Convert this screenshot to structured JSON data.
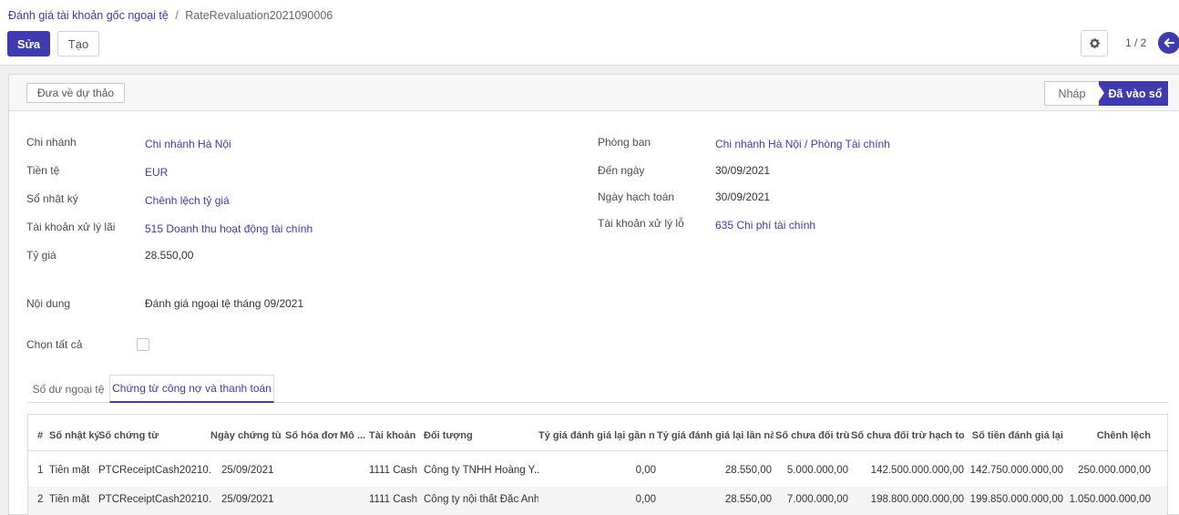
{
  "breadcrumb": {
    "parent": "Đánh giá tài khoản gốc ngoại tệ",
    "separator": "/",
    "current": "RateRevaluation2021090006"
  },
  "toolbar": {
    "edit_label": "Sửa",
    "create_label": "Tạo",
    "pager": "1 / 2",
    "gear_icon": "gear-icon",
    "back_icon": "arrow-left-icon"
  },
  "statusbar": {
    "reset_label": "Đưa về dự thảo",
    "stages": [
      "Nháp",
      "Đã vào sổ"
    ],
    "active_stage": "Đã vào sổ"
  },
  "form": {
    "left": [
      {
        "label": "Chi nhánh",
        "value": "Chi nhánh Hà Nội",
        "link": true
      },
      {
        "label": "Tiền tệ",
        "value": "EUR",
        "link": true
      },
      {
        "label": "Sổ nhật ký",
        "value": "Chênh lệch tỷ giá",
        "link": true
      },
      {
        "label": "Tài khoản xử lý lãi",
        "value": "515 Doanh thu hoạt động tài chính",
        "link": true
      },
      {
        "label": "Tỷ giá",
        "value": "28.550,00",
        "link": false
      }
    ],
    "right": [
      {
        "label": "Phòng ban",
        "value": "Chi nhánh Hà Nội / Phòng Tài chính",
        "link": true
      },
      {
        "label": "Đến ngày",
        "value": "30/09/2021",
        "link": false
      },
      {
        "label": "Ngày hạch toán",
        "value": "30/09/2021",
        "link": false
      },
      {
        "label": "Tài khoản xử lý lỗ",
        "value": "635 Chi phí tài chính",
        "link": true
      }
    ],
    "content_label": "Nội dung",
    "content_value": "Đánh giá ngoại tệ tháng 09/2021",
    "select_all_label": "Chọn tất cả",
    "select_all_checked": false
  },
  "tabs": [
    "Số dư ngoại tệ",
    "Chứng từ công nợ và thanh toán"
  ],
  "active_tab": "Chứng từ công nợ và thanh toán",
  "table": {
    "columns": [
      "#",
      "Số nhật ký",
      "Số chứng từ",
      "Ngày chứng từ",
      "Số hóa đơn",
      "Mô ...",
      "Tài khoản",
      "Đối tượng",
      "Tỷ giá đánh giá lại gần n...",
      "Tỷ giá đánh giá lại lần này",
      "Số chưa đối trừ",
      "Số chưa đối trừ hạch toán",
      "Số tiền đánh giá lại",
      "Chênh lệch"
    ],
    "rows": [
      [
        "1",
        "Tiền mặt",
        "PTCReceiptCash20210...",
        "25/09/2021",
        "",
        "",
        "1111 Cash",
        "Công ty TNHH Hoàng Y...",
        "0,00",
        "28.550,00",
        "5.000.000,00",
        "142.500.000.000,00",
        "142.750.000.000,00",
        "250.000.000,00"
      ],
      [
        "2",
        "Tiền mặt",
        "PTCReceiptCash20210...",
        "25/09/2021",
        "",
        "",
        "1111 Cash",
        "Công ty nội thất Đắc Anh",
        "0,00",
        "28.550,00",
        "7.000.000,00",
        "198.800.000.000,00",
        "199.850.000.000,00",
        "1.050.000.000,00"
      ]
    ]
  },
  "colors": {
    "accent": "#3f3ab0",
    "background": "#f0eeee"
  }
}
